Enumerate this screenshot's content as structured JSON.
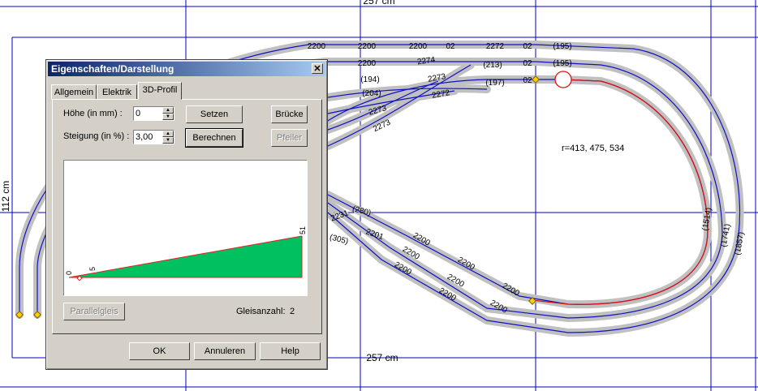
{
  "layout": {
    "top_dimension": "257 cm",
    "bottom_dimension": "257 cm",
    "left_dimension": "112 cm",
    "radius_label": "r=413, 475, 534",
    "colors": {
      "track_bed": "#c0c0c0",
      "track_line": "#1010c8",
      "highlight_track": "#e01010",
      "grid": "#0000c0"
    },
    "track_labels": [
      "2200",
      "2200",
      "2200",
      "02",
      "2272",
      "02",
      "(195)",
      "2200",
      "2274",
      "(213)",
      "02",
      "(195)",
      "(194)",
      "2273",
      "(197)",
      "02",
      "(204)",
      "2272",
      "2273",
      "2273",
      "(280)",
      "2231",
      "2201",
      "(305)",
      "2200",
      "2200",
      "2200",
      "2200",
      "2200",
      "2200",
      "2200",
      "2200",
      "(1514)",
      "(1741)",
      "(1857)"
    ]
  },
  "dialog": {
    "title": "Eigenschaften/Darstellung",
    "close_icon": "close-icon",
    "tabs": [
      "Allgemein",
      "Elektrik",
      "3D-Profil"
    ],
    "active_tab": "3D-Profil",
    "height_label": "Höhe (in mm) :",
    "height_value": "0",
    "slope_label": "Steigung (in %) :",
    "slope_value": "3,00",
    "setzen_label": "Setzen",
    "berechnen_label": "Berechnen",
    "bruecke_label": "Brücke",
    "pfeiler_label": "Pfeiler",
    "profile": {
      "start_height": "0",
      "mid_marker": "5",
      "end_height": "51",
      "fill_color": "#00c060"
    },
    "parallel_label": "Parallelgleis",
    "track_count_label": "Gleisanzahl:",
    "track_count_value": "2",
    "ok_label": "OK",
    "cancel_label": "Annuleren",
    "help_label": "Help"
  }
}
